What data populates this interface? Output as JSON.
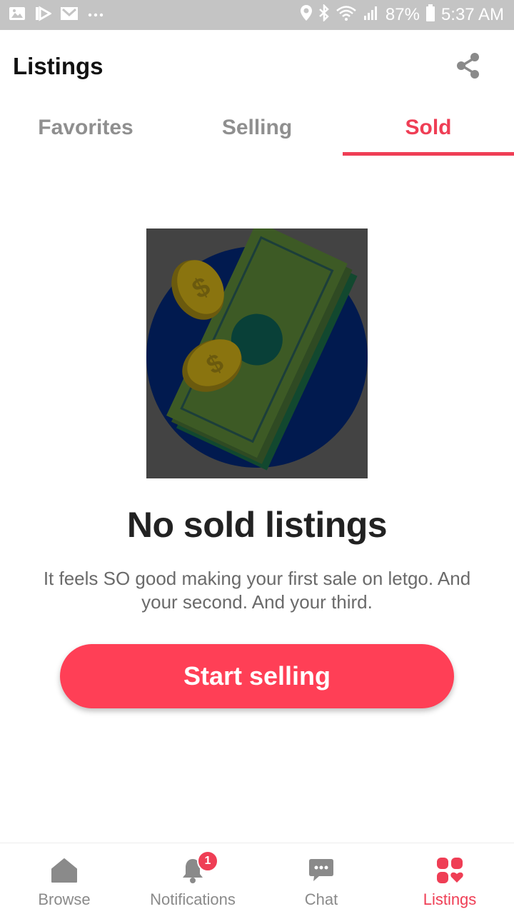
{
  "status_bar": {
    "battery": "87%",
    "time": "5:37 AM",
    "left_icons": [
      "image-icon",
      "play-store-icon",
      "gmail-icon",
      "more-dots-icon"
    ],
    "right_icons": [
      "location-icon",
      "bluetooth-icon",
      "wifi-icon",
      "signal-icon",
      "battery-icon"
    ]
  },
  "header": {
    "title": "Listings",
    "share_icon": "share-icon"
  },
  "tabs": [
    {
      "label": "Favorites",
      "active": false
    },
    {
      "label": "Selling",
      "active": false
    },
    {
      "label": "Sold",
      "active": true
    }
  ],
  "empty_state": {
    "illustration": "money-bills-coins-illustration",
    "title": "No sold listings",
    "message": "It feels SO good making your first sale on letgo. And your second. And your third.",
    "button_label": "Start selling"
  },
  "bottom_nav": [
    {
      "label": "Browse",
      "icon": "home-icon",
      "active": false
    },
    {
      "label": "Notifications",
      "icon": "bell-icon",
      "active": false,
      "badge": "1"
    },
    {
      "label": "Chat",
      "icon": "chat-icon",
      "active": false
    },
    {
      "label": "Listings",
      "icon": "listings-grid-icon",
      "active": true
    }
  ],
  "colors": {
    "accent": "#ef3e55",
    "button": "#ff3f56",
    "status_bar": "#c4c4c4",
    "inactive": "#8f8f8f"
  }
}
